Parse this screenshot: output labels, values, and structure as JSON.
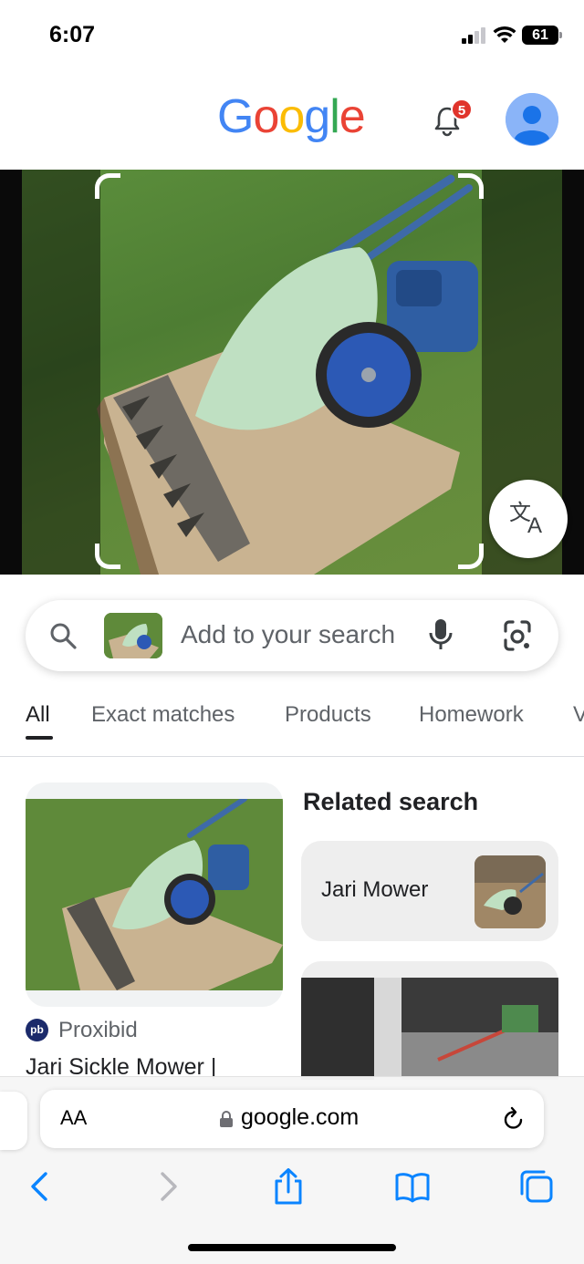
{
  "status_bar": {
    "time": "6:07",
    "battery": "61",
    "icons": [
      "cellular-signal-icon",
      "wifi-icon",
      "battery-icon"
    ]
  },
  "header": {
    "logo_letters": [
      {
        "char": "G",
        "color": "#4285F4"
      },
      {
        "char": "o",
        "color": "#EA4335"
      },
      {
        "char": "o",
        "color": "#FBBC05"
      },
      {
        "char": "g",
        "color": "#4285F4"
      },
      {
        "char": "l",
        "color": "#34A853"
      },
      {
        "char": "e",
        "color": "#EA4335"
      }
    ],
    "notification_count": "5",
    "icons": [
      "bell-icon",
      "avatar-icon"
    ]
  },
  "image_viewer": {
    "icons": [
      "crop-corner-icon",
      "translate-icon"
    ]
  },
  "search": {
    "placeholder": "Add to your search",
    "icons": [
      "search-icon",
      "microphone-icon",
      "google-lens-icon"
    ]
  },
  "tabs": [
    {
      "label": "All",
      "active": true
    },
    {
      "label": "Exact matches",
      "active": false
    },
    {
      "label": "Products",
      "active": false
    },
    {
      "label": "Homework",
      "active": false
    },
    {
      "label": "V",
      "active": false
    }
  ],
  "results": {
    "first": {
      "source_logo": "pb",
      "source": "Proxibid",
      "title": "Jari Sickle Mower |"
    },
    "related_heading": "Related search",
    "related": [
      {
        "label": "Jari Mower"
      }
    ]
  },
  "browser": {
    "aa_label": "AA",
    "url": "google.com",
    "icons": [
      "lock-icon",
      "reload-icon",
      "back-icon",
      "forward-icon",
      "share-icon",
      "bookmarks-icon",
      "tabs-icon"
    ]
  },
  "colors": {
    "accent_blue": "#4285F4",
    "badge_red": "#e0342b",
    "safari_blue": "#0a84ff"
  }
}
